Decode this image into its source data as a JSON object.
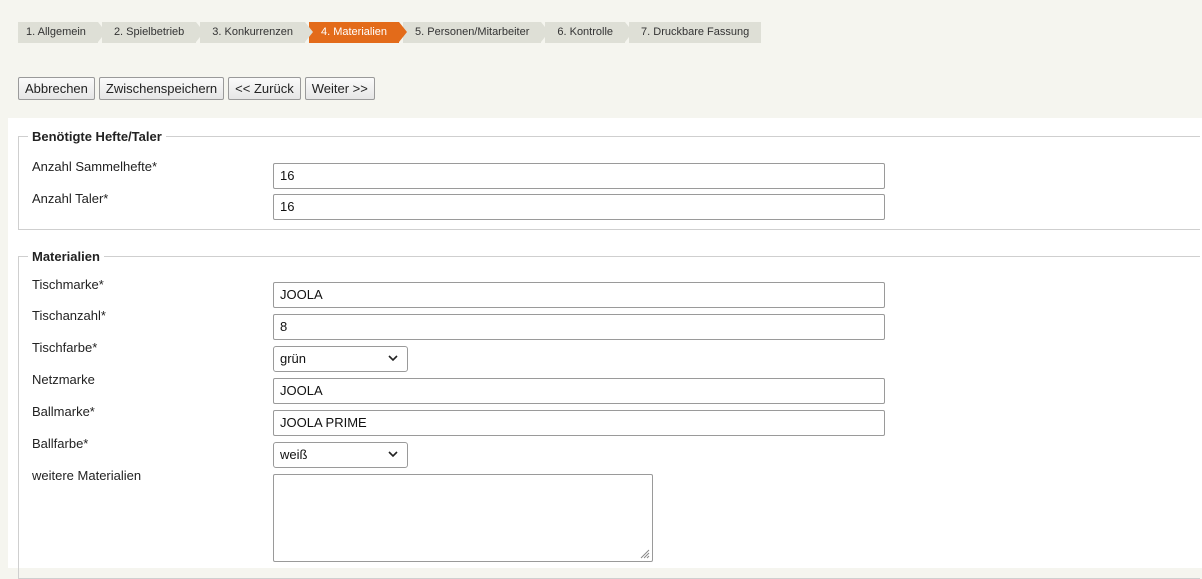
{
  "steps": [
    {
      "label": "1. Allgemein"
    },
    {
      "label": "2. Spielbetrieb"
    },
    {
      "label": "3. Konkurrenzen"
    },
    {
      "label": "4. Materialien",
      "active": true
    },
    {
      "label": "5. Personen/Mitarbeiter"
    },
    {
      "label": "6. Kontrolle"
    },
    {
      "label": "7. Druckbare Fassung"
    }
  ],
  "buttons": {
    "cancel": "Abbrechen",
    "save": "Zwischenspeichern",
    "back": "<< Zurück",
    "next": "Weiter >>"
  },
  "hefte": {
    "legend": "Benötigte Hefte/Taler",
    "sammelhefte_label": "Anzahl Sammelhefte*",
    "sammelhefte_value": "16",
    "taler_label": "Anzahl Taler*",
    "taler_value": "16"
  },
  "materialien": {
    "legend": "Materialien",
    "tischmarke_label": "Tischmarke*",
    "tischmarke_value": "JOOLA",
    "tischanzahl_label": "Tischanzahl*",
    "tischanzahl_value": "8",
    "tischfarbe_label": "Tischfarbe*",
    "tischfarbe_value": "grün",
    "netzmarke_label": "Netzmarke",
    "netzmarke_value": "JOOLA",
    "ballmarke_label": "Ballmarke*",
    "ballmarke_value": "JOOLA PRIME",
    "ballfarbe_label": "Ballfarbe*",
    "ballfarbe_value": "weiß",
    "weitere_label": "weitere Materialien",
    "weitere_value": ""
  },
  "colors": {
    "active_step": "#e36b1a",
    "inactive_step": "#dedfd6",
    "page_background": "#f5f5ef"
  },
  "icons": {
    "dropdown": "chevron-down-icon",
    "resize": "resize-grip-icon"
  }
}
